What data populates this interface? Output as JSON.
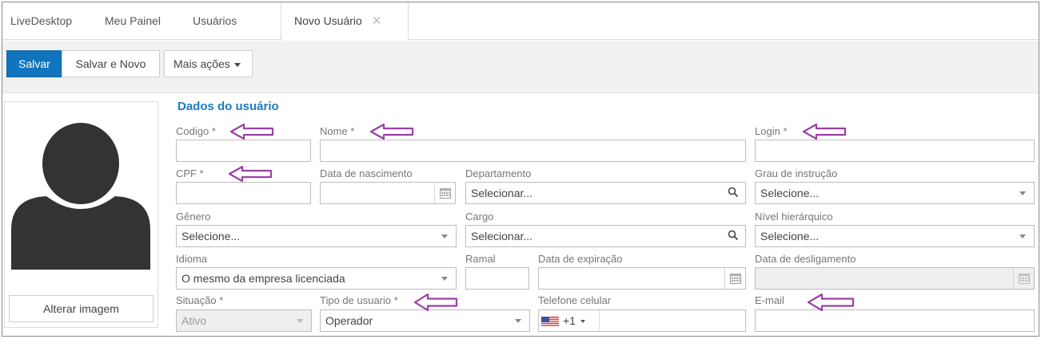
{
  "tabs": [
    {
      "label": "LiveDesktop"
    },
    {
      "label": "Meu Painel"
    },
    {
      "label": "Usuários"
    },
    {
      "label": "Novo Usuário",
      "active": true
    }
  ],
  "tab_close_glyph": "✕",
  "toolbar": {
    "save_label": "Salvar",
    "save_new_label": "Salvar e Novo",
    "more_actions_label": "Mais ações"
  },
  "avatar": {
    "change_image_label": "Alterar imagem"
  },
  "form": {
    "section_title": "Dados do usuário",
    "codigo": {
      "label": "Codigo *",
      "value": ""
    },
    "nome": {
      "label": "Nome *",
      "value": ""
    },
    "login": {
      "label": "Login *",
      "value": ""
    },
    "cpf": {
      "label": "CPF *",
      "value": ""
    },
    "data_nascimento": {
      "label": "Data de nascimento",
      "value": ""
    },
    "departamento": {
      "label": "Departamento",
      "value": "Selecionar..."
    },
    "grau_instrucao": {
      "label": "Grau de instrução",
      "value": "Selecione..."
    },
    "genero": {
      "label": "Gênero",
      "value": "Selecione..."
    },
    "cargo": {
      "label": "Cargo",
      "value": "Selecionar..."
    },
    "nivel_hierarquico": {
      "label": "Nível hierárquico",
      "value": "Selecione..."
    },
    "idioma": {
      "label": "Idioma",
      "value": "O mesmo da empresa licenciada"
    },
    "ramal": {
      "label": "Ramal",
      "value": ""
    },
    "data_expiracao": {
      "label": "Data de expiração",
      "value": ""
    },
    "data_desligamento": {
      "label": "Data de desligamento",
      "value": ""
    },
    "situacao": {
      "label": "Situação *",
      "value": "Ativo"
    },
    "tipo_usuario": {
      "label": "Tipo de usuario *",
      "value": "Operador"
    },
    "telefone_celular": {
      "label": "Telefone celular",
      "dial_code": "+1",
      "value": ""
    },
    "email": {
      "label": "E-mail",
      "value": ""
    }
  },
  "colors": {
    "primary": "#1175bd",
    "section_title": "#1a7cc4",
    "annotation_arrow": "#9b3fa6"
  },
  "icons": {
    "avatar": "avatar-silhouette-icon",
    "search": "magnifier-icon",
    "calendar": "calendar-icon",
    "flag": "us-flag-icon",
    "annotation": "purple-left-arrow-icon"
  }
}
